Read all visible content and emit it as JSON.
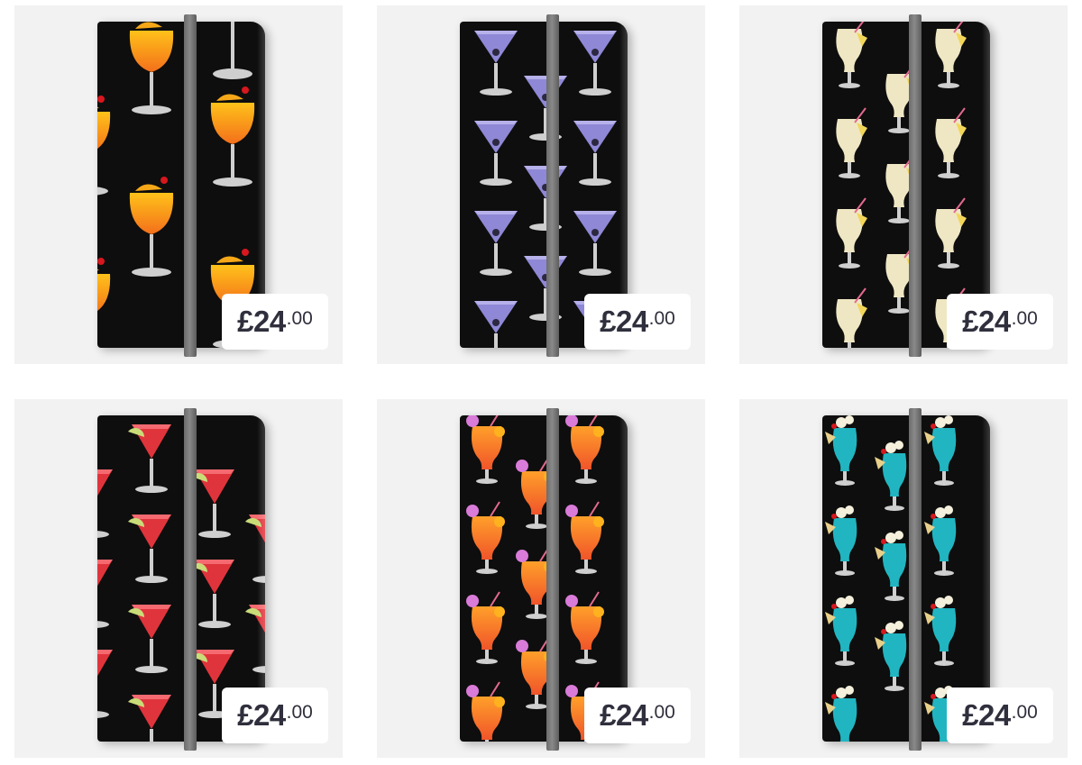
{
  "products": [
    {
      "price_main": "£24",
      "price_cents": ".00",
      "design": "tequila-sunrise-icon",
      "colors": {
        "drink": "#f7a21b",
        "garnish": "#d8171e",
        "glass": "#c8c8c8"
      }
    },
    {
      "price_main": "£24",
      "price_cents": ".00",
      "design": "martini-icon",
      "colors": {
        "drink": "#8f88d6",
        "garnish": "#2c2840",
        "glass": "#c8c8c8"
      }
    },
    {
      "price_main": "£24",
      "price_cents": ".00",
      "design": "pina-colada-icon",
      "colors": {
        "drink": "#efe7c4",
        "garnish": "#e46a8f",
        "glass": "#c8c8c8"
      }
    },
    {
      "price_main": "£24",
      "price_cents": ".00",
      "design": "cosmopolitan-icon",
      "colors": {
        "drink": "#e0343c",
        "garnish": "#c9dc78",
        "glass": "#c8c8c8"
      }
    },
    {
      "price_main": "£24",
      "price_cents": ".00",
      "design": "hurricane-cocktail-icon",
      "colors": {
        "drink": "#f58a2a",
        "garnish": "#d97bd8",
        "glass": "#c8c8c8"
      }
    },
    {
      "price_main": "£24",
      "price_cents": ".00",
      "design": "blue-hawaiian-icon",
      "colors": {
        "drink": "#21b5c1",
        "garnish": "#e9d08a",
        "glass": "#c8c8c8"
      }
    }
  ]
}
